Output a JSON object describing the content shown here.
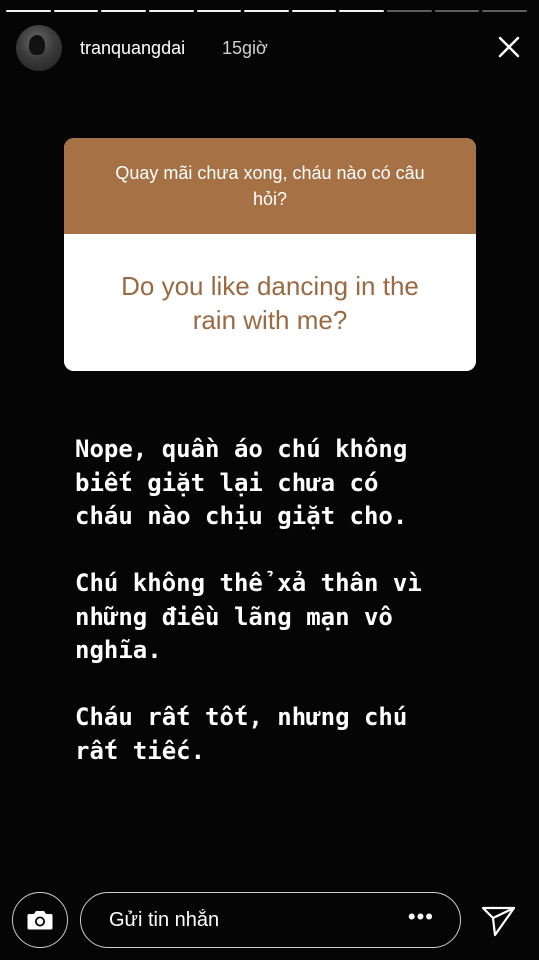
{
  "story": {
    "progress_segments": 11,
    "progress_completed": 8
  },
  "header": {
    "username": "tranquangdai",
    "time": "15giờ",
    "close_icon": "close-icon"
  },
  "question_card": {
    "prompt": "Quay mãi chưa xong, cháu nào có câu hỏi?",
    "question": "Do you like dancing in the rain with me?",
    "header_color": "#a67245",
    "question_color": "#9a6a43"
  },
  "reply": {
    "paragraphs": [
      "Nope, quần áo chú không\nbiết giặt lại chưa có\ncháu nào chịu giặt cho.",
      "Chú không thể xả thân vì\nnhững điều lãng mạn vô\nnghĩa.",
      "Cháu rất tốt, nhưng chú\nrất tiếc."
    ]
  },
  "footer": {
    "camera_icon": "camera-icon",
    "message_placeholder": "Gửi tin nhắn",
    "more_label": "•••",
    "send_icon": "send-icon"
  }
}
